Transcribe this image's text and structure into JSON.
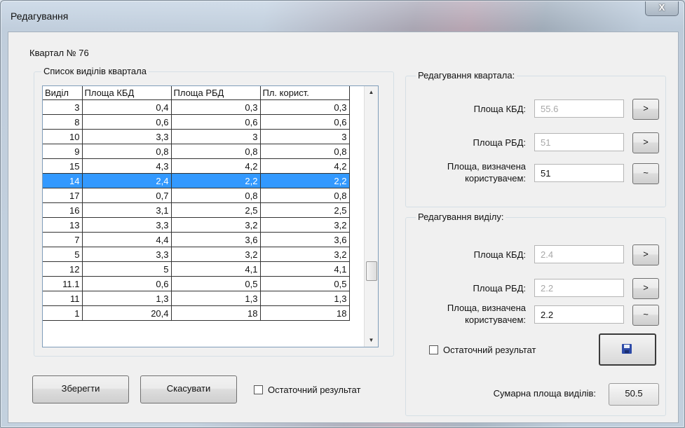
{
  "window": {
    "title": "Редагування",
    "close_label": "X"
  },
  "kvartal_label": "Квартал № 76",
  "list_group": {
    "legend": "Список виділів квартала",
    "columns": [
      "Виділ",
      "Площа КБД",
      "Площа РБД",
      "Пл. корист."
    ],
    "rows": [
      [
        "3",
        "0,4",
        "0,3",
        "0,3"
      ],
      [
        "8",
        "0,6",
        "0,6",
        "0,6"
      ],
      [
        "10",
        "3,3",
        "3",
        "3"
      ],
      [
        "9",
        "0,8",
        "0,8",
        "0,8"
      ],
      [
        "15",
        "4,3",
        "4,2",
        "4,2"
      ],
      [
        "14",
        "2,4",
        "2,2",
        "2,2"
      ],
      [
        "17",
        "0,7",
        "0,8",
        "0,8"
      ],
      [
        "16",
        "3,1",
        "2,5",
        "2,5"
      ],
      [
        "13",
        "3,3",
        "3,2",
        "3,2"
      ],
      [
        "7",
        "4,4",
        "3,6",
        "3,6"
      ],
      [
        "5",
        "3,3",
        "3,2",
        "3,2"
      ],
      [
        "12",
        "5",
        "4,1",
        "4,1"
      ],
      [
        "11.1",
        "0,6",
        "0,5",
        "0,5"
      ],
      [
        "11",
        "1,3",
        "1,3",
        "1,3"
      ],
      [
        "1",
        "20,4",
        "18",
        "18"
      ]
    ],
    "selected_row": 5
  },
  "bottom": {
    "save_label": "Зберегти",
    "cancel_label": "Скасувати",
    "final_result_label": "Остаточний результат"
  },
  "quarter_group": {
    "legend": "Редагування квартала:",
    "kbd_label": "Площа КБД:",
    "kbd_value": "55.6",
    "rbd_label": "Площа РБД:",
    "rbd_value": "51",
    "user_label_1": "Площа, визначена",
    "user_label_2": "користувачем:",
    "user_value": "51",
    "arrow_label": ">",
    "tilde_label": "~"
  },
  "allot_group": {
    "legend": "Редагування виділу:",
    "kbd_label": "Площа КБД:",
    "kbd_value": "2.4",
    "rbd_label": "Площа РБД:",
    "rbd_value": "2.2",
    "user_label_1": "Площа, визначена",
    "user_label_2": "користувачем:",
    "user_value": "2.2",
    "arrow_label": ">",
    "tilde_label": "~",
    "final_result_label": "Остаточний результат",
    "total_label": "Сумарна площа виділів:",
    "total_value": "50.5"
  }
}
